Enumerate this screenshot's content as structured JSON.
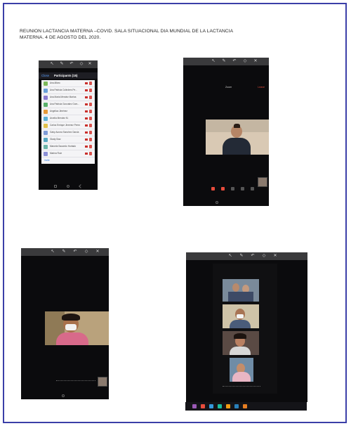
{
  "document": {
    "heading_line1": "REUNION LACTANCIA MATERNA –COVID. SALA SITUACIONAL DIA MUNDIAL DE LA LACTANCIA",
    "heading_line2": "MATERNA. 4 DE AGOSTO DEL 2020."
  },
  "participants_screen": {
    "header_left": "Close",
    "header_title": "Participants (15)",
    "invite_label": "Invite",
    "avatar_colors": [
      "#7cb85a",
      "#6aa0d8",
      "#8a7bd0",
      "#58b06a",
      "#e59a3a",
      "#5bb0d6",
      "#e0c04a",
      "#7e9bd6",
      "#56a7c0",
      "#6bb5a8",
      "#8b8fd6",
      "#52a9d8"
    ],
    "participants": [
      "Ana Alfaro",
      "Ana Patricia Colindres Pe...",
      "Ana Maria Mendez Marina",
      "Ana Patricia Gonzalez Gom...",
      "Angelica Jiménez",
      "Arcelia Mendez M.",
      "Carlos Enrique Jimenez Perez",
      "Gaby Aurora Sanchez Garcia",
      "Glady Diaz",
      "Marcela Saucedo Hurtado",
      "Marina Ruiz"
    ]
  },
  "video_screen_1": {
    "top_label": "Zoom",
    "leave_label": "Leave"
  },
  "video_screen_2": {
    "top_label": "Zoom"
  },
  "gallery_screen": {
    "top_label": "Zoom"
  },
  "taskbar": {
    "icon_colors": [
      "#9b59b6",
      "#e74c3c",
      "#3498db",
      "#1abc9c",
      "#f39c12",
      "#2980b9",
      "#e67e22"
    ]
  }
}
